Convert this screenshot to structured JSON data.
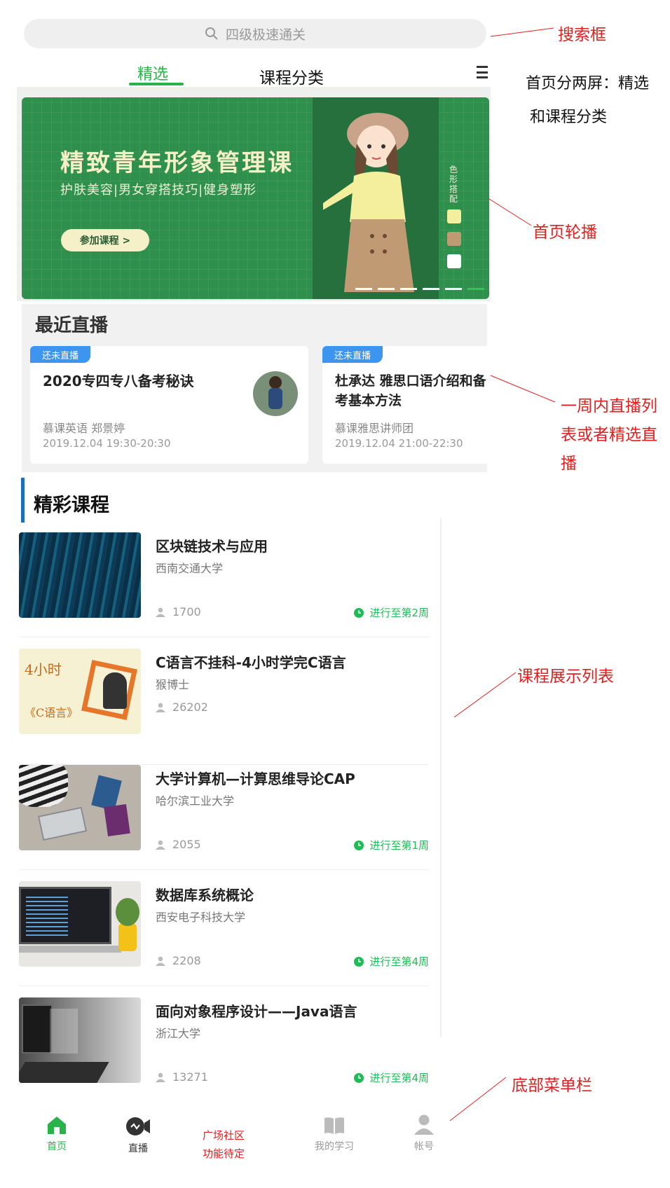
{
  "search": {
    "placeholder": "四级极速通关"
  },
  "tabs": [
    {
      "label": "精选",
      "active": true
    },
    {
      "label": "课程分类",
      "active": false
    }
  ],
  "banner": {
    "title": "精致青年形象管理课",
    "subtitle": "护肤美容|男女穿搭技巧|健身塑形",
    "button": "参加课程 >",
    "side_text": "色形搭配",
    "slide_count": 6,
    "active_slide": 6
  },
  "live": {
    "title": "最近直播",
    "cards": [
      {
        "badge": "还未直播",
        "name": "2020专四专八备考秘诀",
        "host": "慕课英语 郑景婷",
        "time": "2019.12.04 19:30-20:30"
      },
      {
        "badge": "还未直播",
        "name": "杜承达 雅思口语介绍和备考基本方法",
        "host": "慕课雅思讲师团",
        "time": "2019.12.04 21:00-22:30"
      }
    ]
  },
  "courses": {
    "title": "精彩课程",
    "items": [
      {
        "title": "区块链技术与应用",
        "school": "西南交通大学",
        "users": "1700",
        "progress": "进行至第2周"
      },
      {
        "title": "C语言不挂科-4小时学完C语言",
        "school": "猴博士",
        "users": "26202",
        "progress": ""
      },
      {
        "title": "大学计算机—计算思维导论CAP",
        "school": "哈尔滨工业大学",
        "users": "2055",
        "progress": "进行至第1周"
      },
      {
        "title": "数据库系统概论",
        "school": "西安电子科技大学",
        "users": "2208",
        "progress": "进行至第4周"
      },
      {
        "title": "面向对象程序设计——Java语言",
        "school": "浙江大学",
        "users": "13271",
        "progress": "进行至第4周"
      }
    ],
    "thumb2": {
      "line1": "4小时",
      "line2": "《C语言》"
    }
  },
  "nav": {
    "home": "首页",
    "live": "直播",
    "square_line1": "广场社区",
    "square_line2": "功能待定",
    "study": "我的学习",
    "account": "帐号"
  },
  "annotations": {
    "search": "搜索框",
    "tabs_line1": "首页分两屏：精选",
    "tabs_line2": "和课程分类",
    "banner": "首页轮播",
    "live_line1": "一周内直播列",
    "live_line2": "表或者精选直",
    "live_line3": "播",
    "courses": "课程展示列表",
    "nav": "底部菜单栏"
  },
  "colors": {
    "accent": "#29b34a",
    "annotation": "#e02020",
    "badge": "#3d95f0"
  }
}
